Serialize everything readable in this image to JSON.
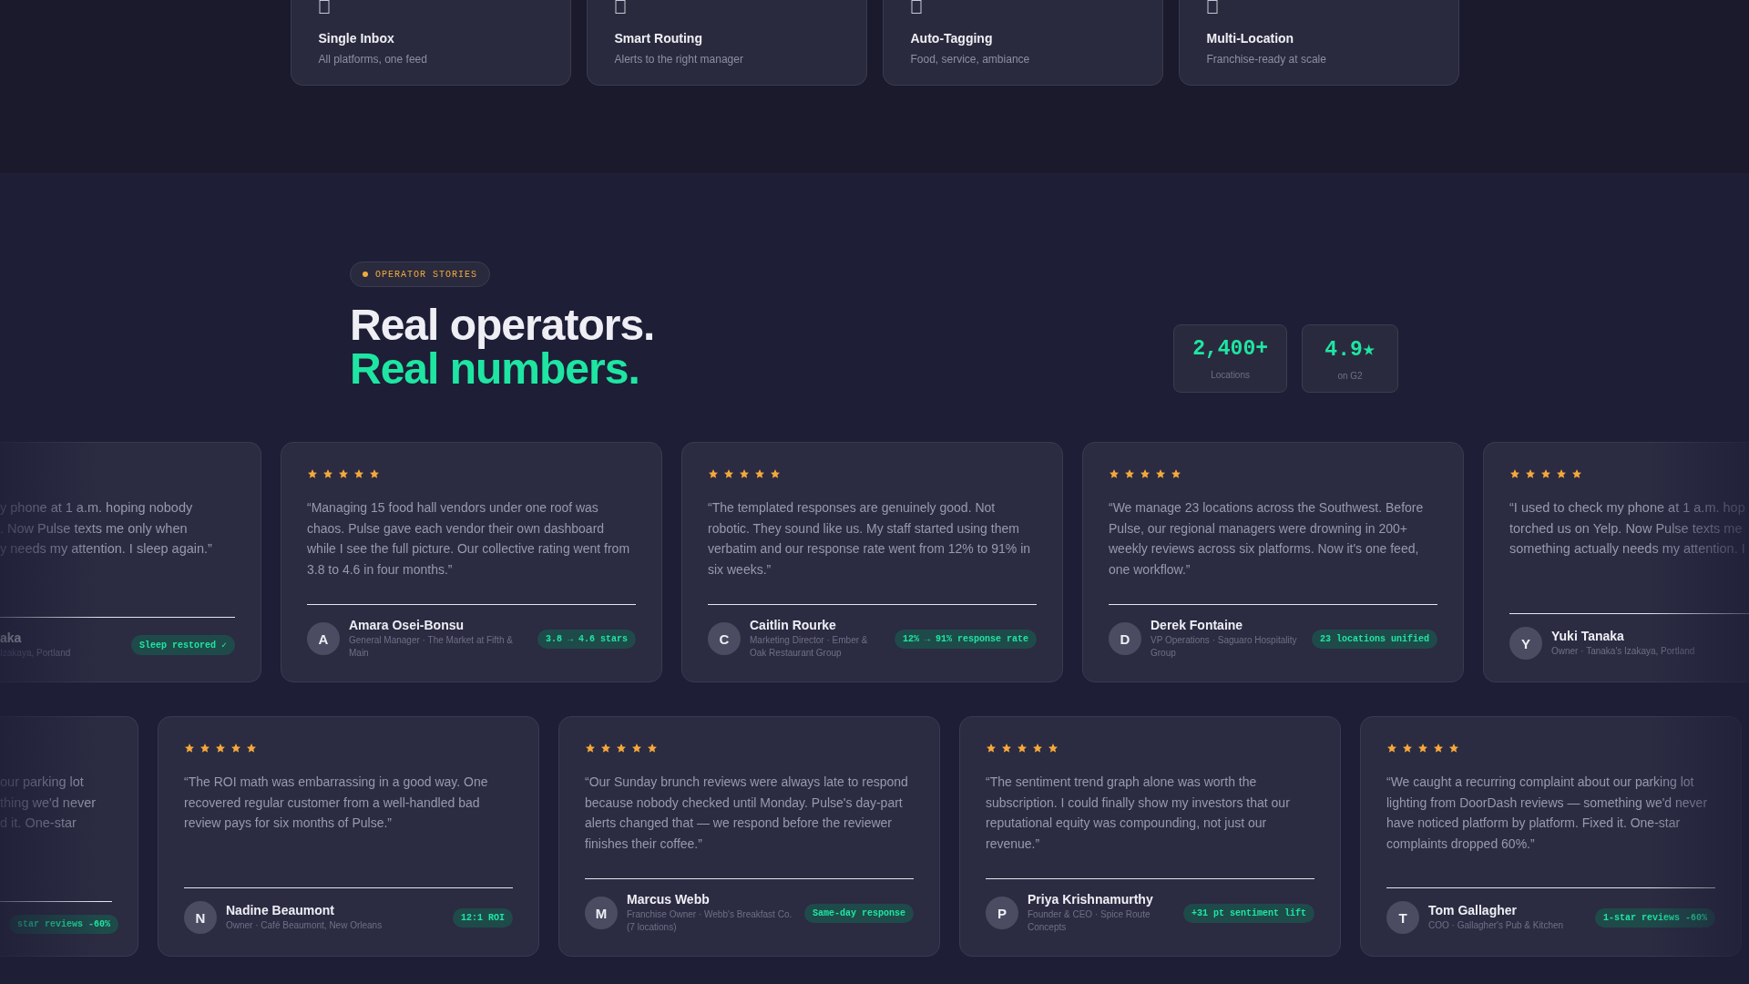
{
  "features": [
    {
      "title": "Single Inbox",
      "subtitle": "All platforms, one feed"
    },
    {
      "title": "Smart Routing",
      "subtitle": "Alerts to the right manager"
    },
    {
      "title": "Auto-Tagging",
      "subtitle": "Food, service, ambiance"
    },
    {
      "title": "Multi-Location",
      "subtitle": "Franchise-ready at scale"
    }
  ],
  "section": {
    "eyebrow": "OPERATOR STORIES",
    "headline_line_1": "Real operators.",
    "headline_line_2": "Real numbers.",
    "stats": [
      {
        "value": "2,400+",
        "label": "Locations"
      },
      {
        "value": "4.9★",
        "label": "on G2"
      }
    ]
  },
  "testimonial_rows": [
    [
      {
        "kind": "cut_left",
        "quote_lines": [
          "y phone at 1 a.m. hoping nobody",
          ". Now Pulse texts me only when",
          "y needs my attention. I sleep again.”"
        ],
        "name": "aka",
        "role": "Izakaya, Portland",
        "badge": "Sleep restored ✓"
      },
      {
        "kind": "full",
        "stars": 5,
        "quote": "“Managing 15 food hall vendors under one roof was chaos. Pulse gave each vendor their own dashboard while I see the full picture. Our collective rating went from 3.8 to 4.6 in four months.”",
        "initial": "A",
        "name": "Amara Osei-Bonsu",
        "role": "General Manager · The Market at Fifth & Main",
        "badge": "3.8 → 4.6 stars"
      },
      {
        "kind": "full",
        "stars": 5,
        "quote": "“The templated responses are genuinely good. Not robotic. They sound like us. My staff started using them verbatim and our response rate went from 12% to 91% in six weeks.”",
        "initial": "C",
        "name": "Caitlin Rourke",
        "role": "Marketing Director · Ember & Oak Restaurant Group",
        "badge": "12% → 91% response rate"
      },
      {
        "kind": "full",
        "stars": 5,
        "quote": "“We manage 23 locations across the Southwest. Before Pulse, our regional managers were drowning in 200+ weekly reviews across six platforms. Now it's one feed, one workflow.”",
        "initial": "D",
        "name": "Derek Fontaine",
        "role": "VP Operations · Saguaro Hospitality Group",
        "badge": "23 locations unified"
      },
      {
        "kind": "cut_right",
        "stars": 5,
        "quote_lines": [
          "“I used to check my phone at 1 a.m. hop",
          "torched us on Yelp. Now Pulse texts me",
          "something actually needs my attention. I"
        ],
        "initial": "Y",
        "name": "Yuki Tanaka",
        "role": "Owner · Tanaka's Izakaya, Portland"
      }
    ],
    [
      {
        "kind": "cut_left",
        "quote_lines": [
          "our parking lot",
          "thing we'd never",
          "d it. One-star"
        ],
        "badge": "star reviews -60%"
      },
      {
        "kind": "full",
        "stars": 5,
        "quote": "“The ROI math was embarrassing in a good way. One recovered regular customer from a well-handled bad review pays for six months of Pulse.”",
        "initial": "N",
        "name": "Nadine Beaumont",
        "role": "Owner · Café Beaumont, New Orleans",
        "badge": "12:1 ROI"
      },
      {
        "kind": "full",
        "stars": 5,
        "quote": "“Our Sunday brunch reviews were always late to respond because nobody checked until Monday. Pulse's day-part alerts changed that — we respond before the reviewer finishes their coffee.”",
        "initial": "M",
        "name": "Marcus Webb",
        "role": "Franchise Owner · Webb's Breakfast Co. (7 locations)",
        "badge": "Same-day response"
      },
      {
        "kind": "full",
        "stars": 5,
        "quote": "“The sentiment trend graph alone was worth the subscription. I could finally show my investors that our reputational equity was compounding, not just our revenue.”",
        "initial": "P",
        "name": "Priya Krishnamurthy",
        "role": "Founder & CEO · Spice Route Concepts",
        "badge": "+31 pt sentiment lift"
      },
      {
        "kind": "full",
        "stars": 5,
        "quote": "“We caught a recurring complaint about our parking lot lighting from DoorDash reviews — something we'd never have noticed platform by platform. Fixed it. One-star complaints dropped 60%.”",
        "initial": "T",
        "name": "Tom Gallagher",
        "role": "COO · Gallagher's Pub & Kitchen",
        "badge": "1-star reviews -60%"
      }
    ]
  ]
}
